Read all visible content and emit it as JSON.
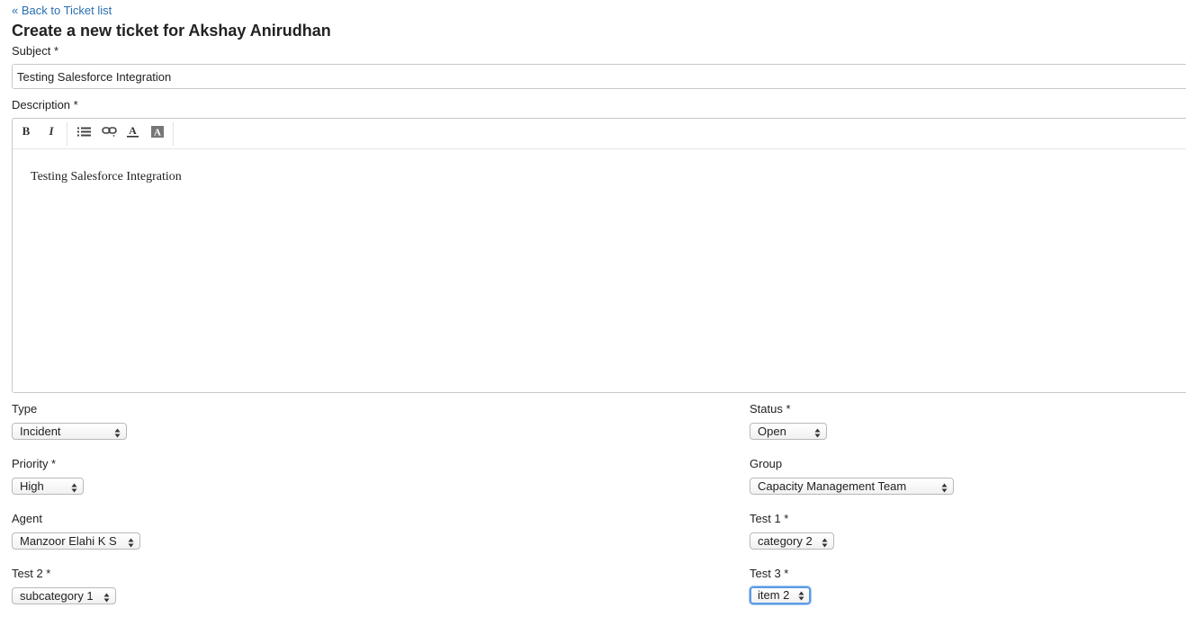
{
  "back_link": "« Back to Ticket list",
  "title": "Create a new ticket for Akshay Anirudhan",
  "subject": {
    "label": "Subject *",
    "value": "Testing Salesforce Integration"
  },
  "description": {
    "label": "Description *",
    "toolbar": {
      "bold": "B",
      "italic": "I",
      "icons": [
        "bold-icon",
        "italic-icon",
        "bulleted-list-icon",
        "link-icon",
        "text-color-icon",
        "background-color-icon"
      ]
    },
    "content": "Testing Salesforce Integration"
  },
  "fields": {
    "type": {
      "label": "Type",
      "value": "Incident"
    },
    "status": {
      "label": "Status *",
      "value": "Open"
    },
    "priority": {
      "label": "Priority *",
      "value": "High"
    },
    "group": {
      "label": "Group",
      "value": "Capacity Management Team"
    },
    "agent": {
      "label": "Agent",
      "value": "Manzoor Elahi K S"
    },
    "test1": {
      "label": "Test 1 *",
      "value": "category 2"
    },
    "test2": {
      "label": "Test 2 *",
      "value": "subcategory 1"
    },
    "test3": {
      "label": "Test 3 *",
      "value": "item 2"
    }
  },
  "colors": {
    "link": "#2a6fb0",
    "focus_ring": "#5a9be6",
    "border": "#c8c8c8"
  }
}
